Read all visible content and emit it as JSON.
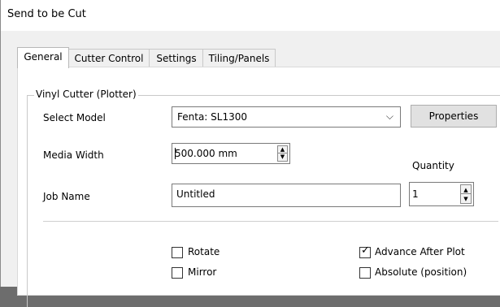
{
  "window": {
    "title": "Send to be Cut"
  },
  "tabs": [
    {
      "label": "General",
      "active": true
    },
    {
      "label": "Cutter Control",
      "active": false
    },
    {
      "label": "Settings",
      "active": false
    },
    {
      "label": "Tiling/Panels",
      "active": false
    }
  ],
  "group": {
    "title": "Vinyl Cutter (Plotter)"
  },
  "fields": {
    "select_model_label": "Select Model",
    "select_model_value": "Fenta: SL1300",
    "properties_button": "Properties",
    "media_width_label": "Media Width",
    "media_width_value": "500.000 mm",
    "quantity_label": "Quantity",
    "quantity_value": "1",
    "job_name_label": "Job Name",
    "job_name_value": "Untitled"
  },
  "options": {
    "rotate": {
      "label": "Rotate",
      "checked": false
    },
    "mirror": {
      "label": "Mirror",
      "checked": false
    },
    "advance_after_plot": {
      "label": "Advance After Plot",
      "checked": true
    },
    "absolute_position": {
      "label": "Absolute (position)",
      "checked": false
    }
  },
  "icons": {
    "dropdown": "chevron-down-icon",
    "spin_up": "spin-up-icon",
    "spin_down": "spin-down-icon",
    "check": "check-icon"
  }
}
